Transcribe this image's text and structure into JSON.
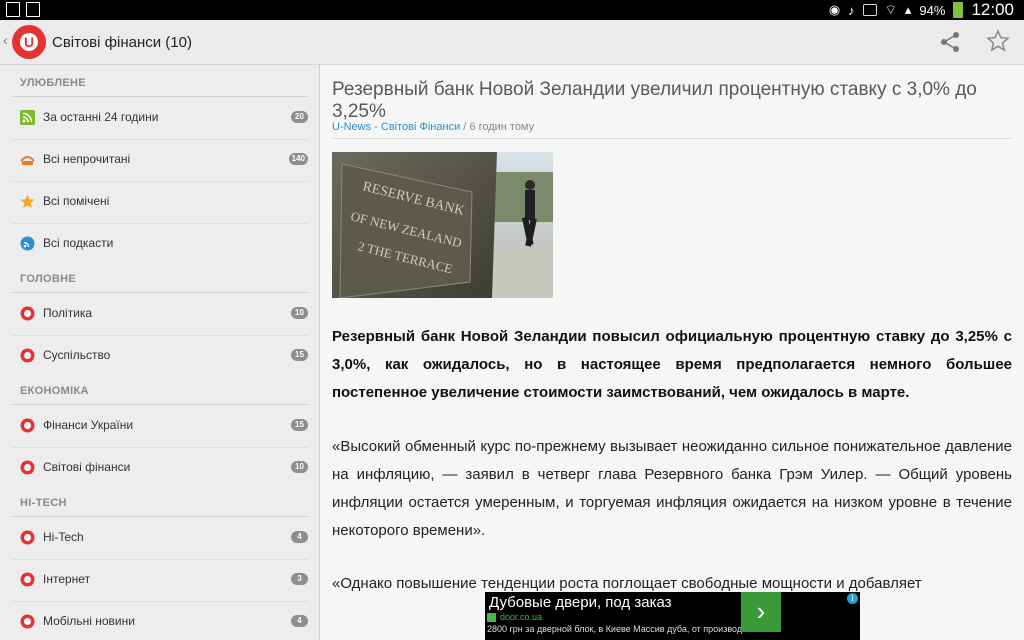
{
  "statusbar": {
    "battery": "94%",
    "time": "12:00",
    "icons": [
      "notification-icon",
      "image-icon",
      "eye-icon",
      "mute-icon",
      "nfc-icon",
      "wifi-icon",
      "signal-icon",
      "battery-icon"
    ]
  },
  "actionbar": {
    "title": "Світові фінанси (10)",
    "logo_letter": "U",
    "accent": "#e53333"
  },
  "sidebar": {
    "sections": [
      {
        "title": "УЛЮБЛЕНЕ"
      },
      {
        "title": "ГОЛОВНЕ"
      },
      {
        "title": "ЕКОНОМІКА"
      },
      {
        "title": "HI-TECH"
      }
    ],
    "items": [
      {
        "label": "За останні 24 години",
        "count": "20",
        "icon": "rss-icon"
      },
      {
        "label": "Всі непрочитані",
        "count": "140",
        "icon": "unread-icon"
      },
      {
        "label": "Всі помічені",
        "count": "",
        "icon": "star-icon"
      },
      {
        "label": "Всі подкасти",
        "count": "",
        "icon": "podcast-icon"
      },
      {
        "label": "Політика",
        "count": "10",
        "icon": "unews-icon"
      },
      {
        "label": "Суспільство",
        "count": "15",
        "icon": "unews-icon"
      },
      {
        "label": "Фінанси України",
        "count": "15",
        "icon": "unews-icon"
      },
      {
        "label": "Світові фінанси",
        "count": "10",
        "icon": "unews-icon"
      },
      {
        "label": "Hi-Tech",
        "count": "4",
        "icon": "unews-icon"
      },
      {
        "label": "Інтернет",
        "count": "3",
        "icon": "unews-icon"
      },
      {
        "label": "Мобільні новини",
        "count": "4",
        "icon": "unews-icon"
      }
    ]
  },
  "article": {
    "title": "Резервный банк Новой Зеландии увеличил процентную ставку с 3,0% до 3,25%",
    "source": "U-News - Світові Фінанси",
    "separator": " / ",
    "time_ago": "6 годин тому",
    "photo_sign": "RESERVE BANK OF NEW ZEALAND 2 THE TERRACE",
    "lead": "Резервный банк Новой Зеландии повысил официальную процентную ставку до 3,25% с 3,0%, как ожидалось, но в настоящее время предполагается немного большее постепенное увеличение стоимости заимствований, чем ожидалось в марте.",
    "p1": "«Высокий обменный курс по-прежнему вызывает неожиданно сильное понижательное давление на инфляцию, — заявил в четверг глава Резервного банка Грэм Уилер. — Общий уровень инфляции остается умеренным, и торгуемая инфляция ожидается на низком уровне в течение некоторого времени».",
    "p2": "«Однако повышение тенденции роста поглощает свободные мощности и добавляет"
  },
  "ad": {
    "title": "Дубовые двери, под заказ",
    "url": "door.co.ua",
    "desc": "2800 грн за дверной блок, в Киеве Массив дуба, от производителя",
    "arrow": "›",
    "info": "i"
  }
}
